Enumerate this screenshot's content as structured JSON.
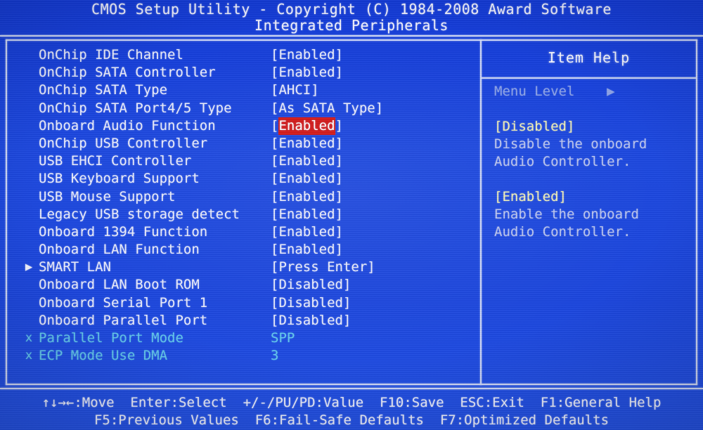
{
  "header": {
    "copyright": "CMOS Setup Utility - Copyright (C) 1984-2008 Award Software",
    "section": "Integrated Peripherals"
  },
  "settings": [
    {
      "marker": "",
      "label": "OnChip IDE Channel",
      "value": "[Enabled]",
      "state": "normal",
      "highlighted": false
    },
    {
      "marker": "",
      "label": "OnChip SATA Controller",
      "value": "[Enabled]",
      "state": "normal",
      "highlighted": false
    },
    {
      "marker": "",
      "label": "OnChip SATA Type",
      "value": "[AHCI]",
      "state": "normal",
      "highlighted": false
    },
    {
      "marker": "",
      "label": "OnChip SATA Port4/5 Type",
      "value": "[As SATA Type]",
      "state": "normal",
      "highlighted": false
    },
    {
      "marker": "",
      "label": "Onboard Audio Function",
      "value": "Enabled",
      "state": "normal",
      "highlighted": true
    },
    {
      "marker": "",
      "label": "OnChip USB Controller",
      "value": "[Enabled]",
      "state": "normal",
      "highlighted": false
    },
    {
      "marker": "",
      "label": "USB EHCI Controller",
      "value": "[Enabled]",
      "state": "normal",
      "highlighted": false
    },
    {
      "marker": "",
      "label": "USB Keyboard Support",
      "value": "[Enabled]",
      "state": "normal",
      "highlighted": false
    },
    {
      "marker": "",
      "label": "USB Mouse Support",
      "value": "[Enabled]",
      "state": "normal",
      "highlighted": false
    },
    {
      "marker": "",
      "label": "Legacy USB storage detect",
      "value": "[Enabled]",
      "state": "normal",
      "highlighted": false
    },
    {
      "marker": "",
      "label": "Onboard 1394 Function",
      "value": "[Enabled]",
      "state": "normal",
      "highlighted": false
    },
    {
      "marker": "",
      "label": "Onboard LAN Function",
      "value": "[Enabled]",
      "state": "normal",
      "highlighted": false
    },
    {
      "marker": "▶",
      "label": "SMART LAN",
      "value": "[Press Enter]",
      "state": "normal",
      "highlighted": false
    },
    {
      "marker": "",
      "label": "Onboard LAN Boot ROM",
      "value": "[Disabled]",
      "state": "normal",
      "highlighted": false
    },
    {
      "marker": "",
      "label": "Onboard Serial Port 1",
      "value": "[Disabled]",
      "state": "normal",
      "highlighted": false
    },
    {
      "marker": "",
      "label": "Onboard Parallel Port",
      "value": "[Disabled]",
      "state": "normal",
      "highlighted": false
    },
    {
      "marker": "x",
      "label": "Parallel Port Mode",
      "value": "SPP",
      "state": "dimmed",
      "highlighted": false
    },
    {
      "marker": "x",
      "label": "ECP Mode Use DMA",
      "value": "3",
      "state": "dimmed",
      "highlighted": false
    }
  ],
  "help": {
    "title": "Item Help",
    "menu_level_label": "Menu Level",
    "menu_level_arrow": "▶",
    "entries": [
      {
        "key": "[Disabled]",
        "desc_line1": "Disable the onboard",
        "desc_line2": "Audio Controller."
      },
      {
        "key": "[Enabled]",
        "desc_line1": "Enable the onboard",
        "desc_line2": "Audio Controller."
      }
    ]
  },
  "footer": {
    "line1": "↑↓→←:Move  Enter:Select  +/-/PU/PD:Value  F10:Save  ESC:Exit  F1:General Help",
    "line2": "F5:Previous Values  F6:Fail-Safe Defaults  F7:Optimized Defaults"
  },
  "colors": {
    "background": "#1a45de",
    "text": "#eceefc",
    "highlight_bg": "#d21414",
    "highlight_text": "#ffffff",
    "dimmed_text": "#63c9ee",
    "help_key": "#f2f0b8",
    "help_desc": "#bcc6ef",
    "frame": "#cfd8f7"
  }
}
